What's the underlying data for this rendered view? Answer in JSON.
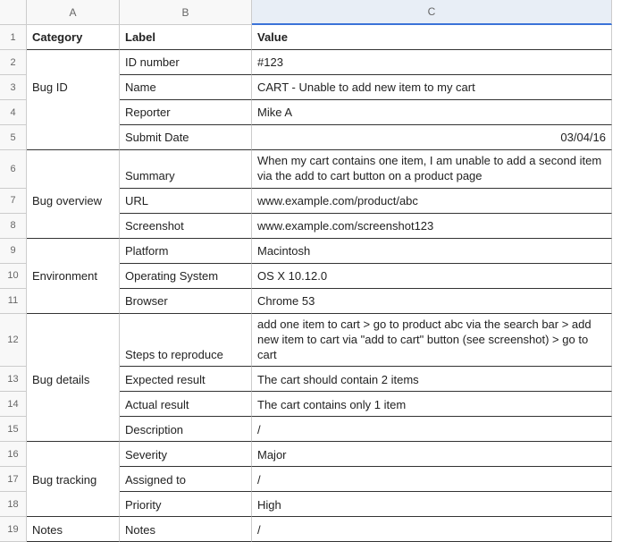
{
  "columns": [
    "A",
    "B",
    "C"
  ],
  "row_numbers": [
    "1",
    "2",
    "3",
    "4",
    "5",
    "6",
    "7",
    "8",
    "9",
    "10",
    "11",
    "12",
    "13",
    "14",
    "15",
    "16",
    "17",
    "18",
    "19"
  ],
  "header_row": {
    "category": "Category",
    "label": "Label",
    "value": "Value"
  },
  "groups": [
    {
      "category": "Bug ID",
      "rows": [
        {
          "label": "ID number",
          "value": "#123"
        },
        {
          "label": "Name",
          "value": "CART - Unable to add new item to my cart"
        },
        {
          "label": "Reporter",
          "value": "Mike A"
        },
        {
          "label": "Submit Date",
          "value": "03/04/16",
          "value_align": "right"
        }
      ]
    },
    {
      "category": "Bug overview",
      "rows": [
        {
          "label": "Summary",
          "value": "When my cart contains one item, I am unable to add a second item via the add to cart button on a product page",
          "wrap": true
        },
        {
          "label": "URL",
          "value": "www.example.com/product/abc"
        },
        {
          "label": "Screenshot",
          "value": "www.example.com/screenshot123"
        }
      ]
    },
    {
      "category": "Environment",
      "rows": [
        {
          "label": "Platform",
          "value": "Macintosh"
        },
        {
          "label": "Operating System",
          "value": "OS X 10.12.0"
        },
        {
          "label": "Browser",
          "value": "Chrome 53"
        }
      ]
    },
    {
      "category": "Bug details",
      "rows": [
        {
          "label": "Steps to reproduce",
          "value": "add one item to cart > go to product abc via the search bar > add new item to cart via \"add to cart\" button (see screenshot) > go to cart",
          "wrap": true
        },
        {
          "label": "Expected result",
          "value": "The cart should contain 2 items"
        },
        {
          "label": "Actual result",
          "value": "The cart contains only 1 item"
        },
        {
          "label": "Description",
          "value": "/"
        }
      ]
    },
    {
      "category": "Bug tracking",
      "rows": [
        {
          "label": "Severity",
          "value": "Major"
        },
        {
          "label": "Assigned to",
          "value": "/"
        },
        {
          "label": "Priority",
          "value": "High"
        }
      ]
    },
    {
      "category": "Notes",
      "rows": [
        {
          "label": "Notes",
          "value": "/"
        }
      ]
    }
  ]
}
